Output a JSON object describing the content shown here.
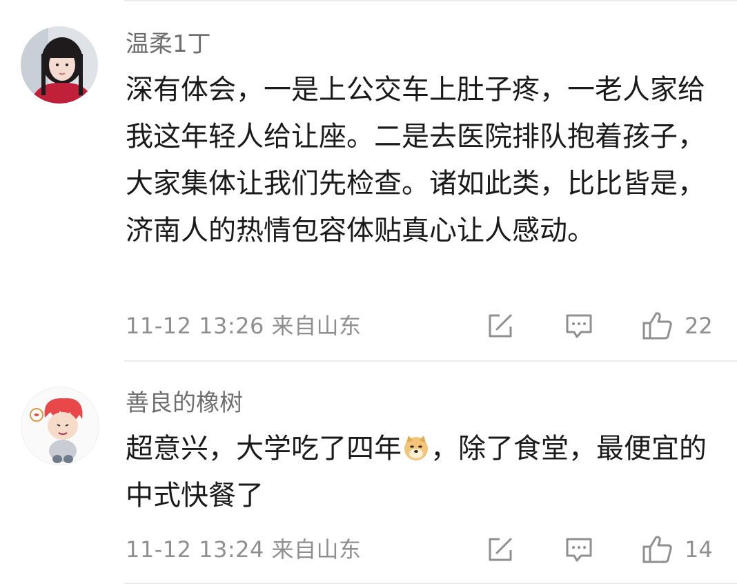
{
  "comments": [
    {
      "username": "温柔1丁",
      "text": "深有体会，一是上公交车上肚子疼，一老人家给我这年轻人给让座。二是去医院排队抱着孩子，大家集体让我们先检查。诸如此类，比比皆是，济南人的热情包容体贴真心让人感动。",
      "time": "11-12 13:26",
      "location": "来自山东",
      "likes": "22"
    },
    {
      "username": "善良的橡树",
      "text_before_emoji": "超意兴，大学吃了四年",
      "emoji": "doge-emoji",
      "text_after_emoji": "，除了食堂，最便宜的中式快餐了",
      "time": "11-12 13:24",
      "location": "来自山东",
      "likes": "14"
    }
  ],
  "icons": {
    "share": "share-edit-icon",
    "reply": "comment-bubble-icon",
    "like": "thumbs-up-icon"
  },
  "colors": {
    "text": "#1a1a1a",
    "muted": "#8f8f8f",
    "username": "#6e6e6e",
    "divider": "#ececec"
  }
}
